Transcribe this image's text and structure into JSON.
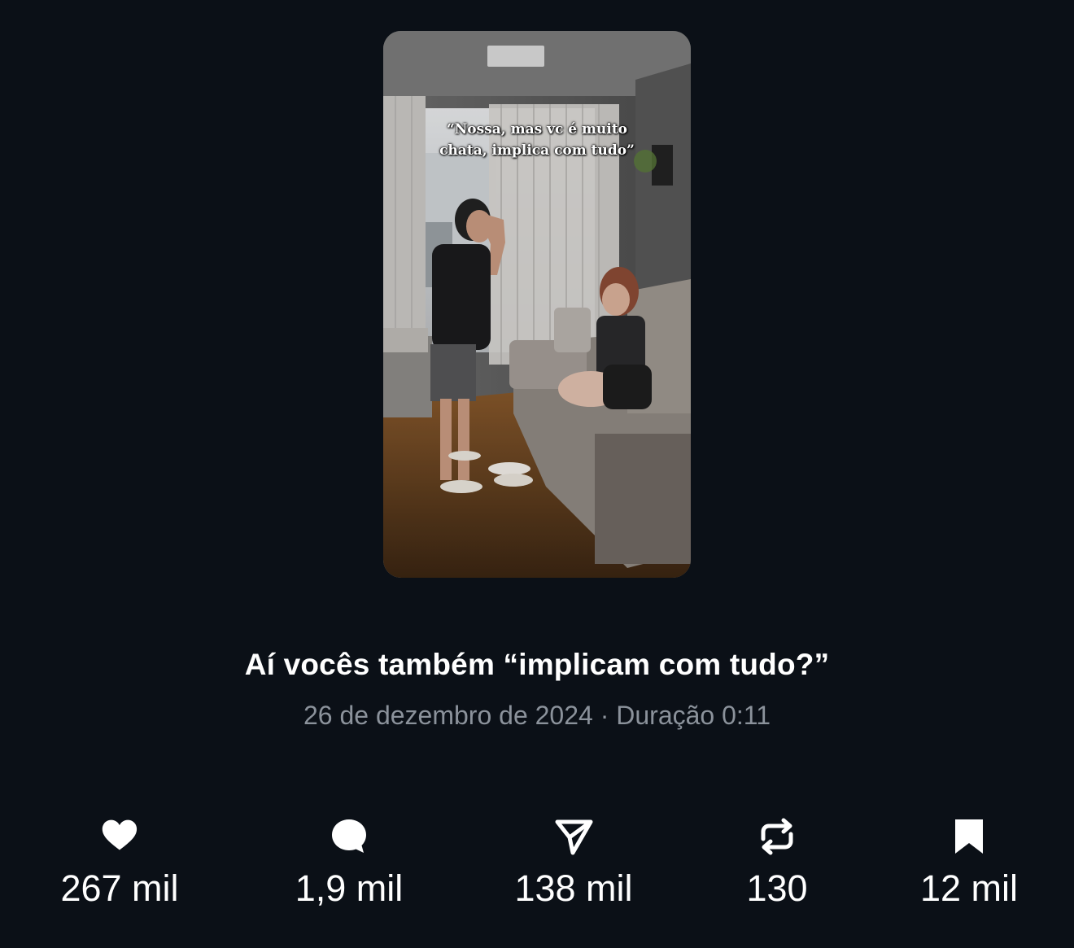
{
  "video": {
    "caption_line1": "“Nossa, mas vc é muito",
    "caption_line2": "chata, implica com tudo”"
  },
  "post": {
    "title": "Aí vocês também “implicam com tudo?”",
    "date": "26 de dezembro de 2024",
    "separator": "·",
    "duration_label": "Duração 0:11"
  },
  "stats": [
    {
      "icon": "heart-icon",
      "count": "267 mil"
    },
    {
      "icon": "comment-icon",
      "count": "1,9 mil"
    },
    {
      "icon": "share-icon",
      "count": "138 mil"
    },
    {
      "icon": "repost-icon",
      "count": "130"
    },
    {
      "icon": "bookmark-icon",
      "count": "12 mil"
    }
  ],
  "colors": {
    "background": "#0b1017",
    "text_primary": "#ffffff",
    "text_secondary": "#8b929b"
  }
}
